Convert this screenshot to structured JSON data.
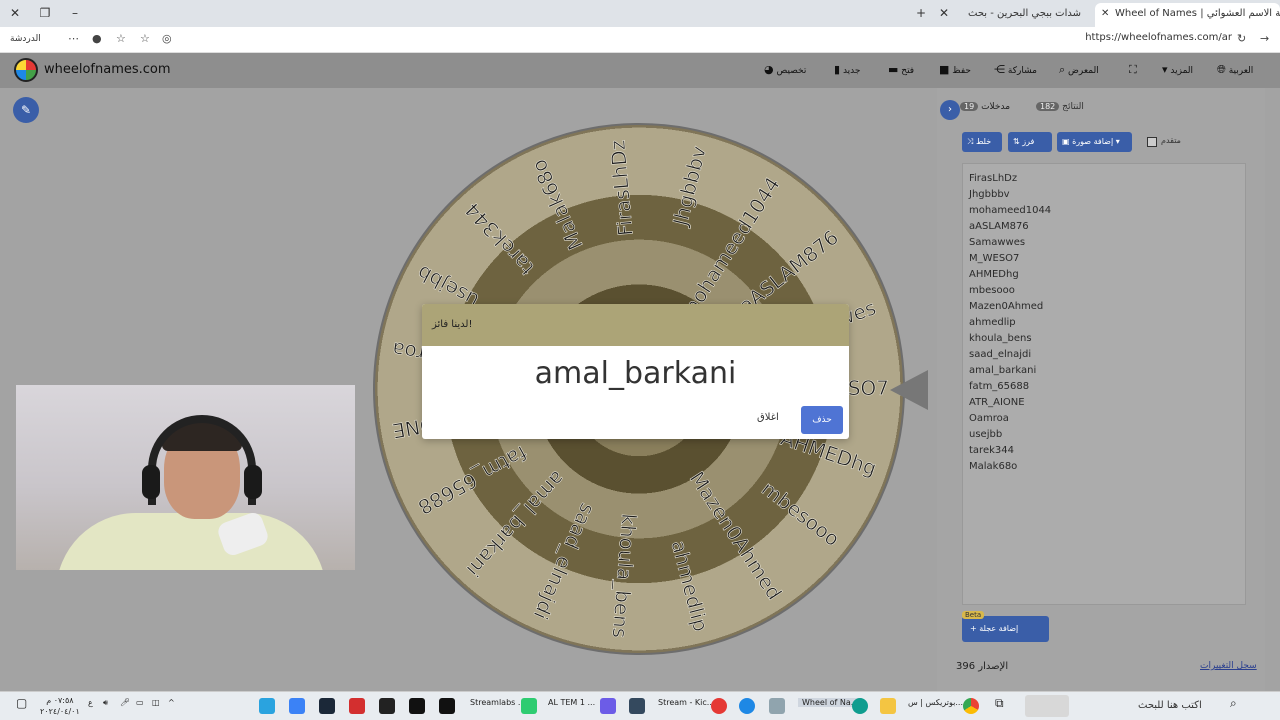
{
  "browser": {
    "tabs": [
      {
        "label": "Wheel of Names | عجلة الاسم العشوائي",
        "active": true
      },
      {
        "label": "شدات ببجي البحرين - بحث",
        "active": false
      }
    ],
    "url": "https://wheelofnames.com/ar",
    "left_label": "الدردشة"
  },
  "site": {
    "name": "wheelofnames.com",
    "menu": {
      "language": "العربية",
      "more": "المزيد",
      "gallery": "المعرض",
      "share": "مشاركة",
      "save": "حفظ",
      "open": "فتح",
      "new": "جديد",
      "customize": "تخصيص"
    }
  },
  "panel": {
    "entries_tab": "مدخلات",
    "entries_count": "19",
    "results_tab": "النتائج",
    "results_count": "182",
    "shuffle": "خلط",
    "sort": "فرز",
    "add_image": "إضافة صورة",
    "advanced": "متقدم",
    "entries": [
      "FirasLhDz",
      "Jhgbbbv",
      "mohameed1044",
      "aASLAM876",
      "Samawwes",
      "M_WESO7",
      "AHMEDhg",
      "mbesooo",
      "Mazen0Ahmed",
      "ahmedlip",
      "khoula_bens",
      "saad_elnajdi",
      "amal_barkani",
      "fatm_65688",
      "ATR_AIONE",
      "Oamroa",
      "usejbb",
      "tarek344",
      "Malak68o"
    ],
    "beta": "Beta",
    "add_wheel": "إضافة عجلة",
    "version_label": "الإصدار",
    "version": "396",
    "changelog": "سجل التغييرات"
  },
  "wheel": {
    "labels": [
      "FirasLhDz",
      "Jhgbbbv",
      "mohameed1044",
      "aASLAM876",
      "Samawwes",
      "M_WESO7",
      "AHMEDhg",
      "mbesooo",
      "Mazen0Ahmed",
      "ahmedlip",
      "khoula_bens",
      "saad_elnajdi",
      "amal_barkani",
      "fatm_65688",
      "ATR_AIONE",
      "Oamroa",
      "usejbb",
      "tarek344",
      "Malak68o"
    ]
  },
  "dialog": {
    "title": "لدينا فائز!",
    "winner": "amal_barkani",
    "close": "اغلاق",
    "remove": "حذف"
  },
  "taskbar": {
    "search": "اكتب هنا للبحث",
    "items": [
      "بوتريكس | س...",
      "Wheel of Na...",
      "Stream - Kic...",
      "AL TEM 1 ...",
      "Streamlabs ..."
    ],
    "time": "٠٧:٥٨ م",
    "date": "٢٠٢٤/٠٤/٠١",
    "lang": "ع"
  }
}
